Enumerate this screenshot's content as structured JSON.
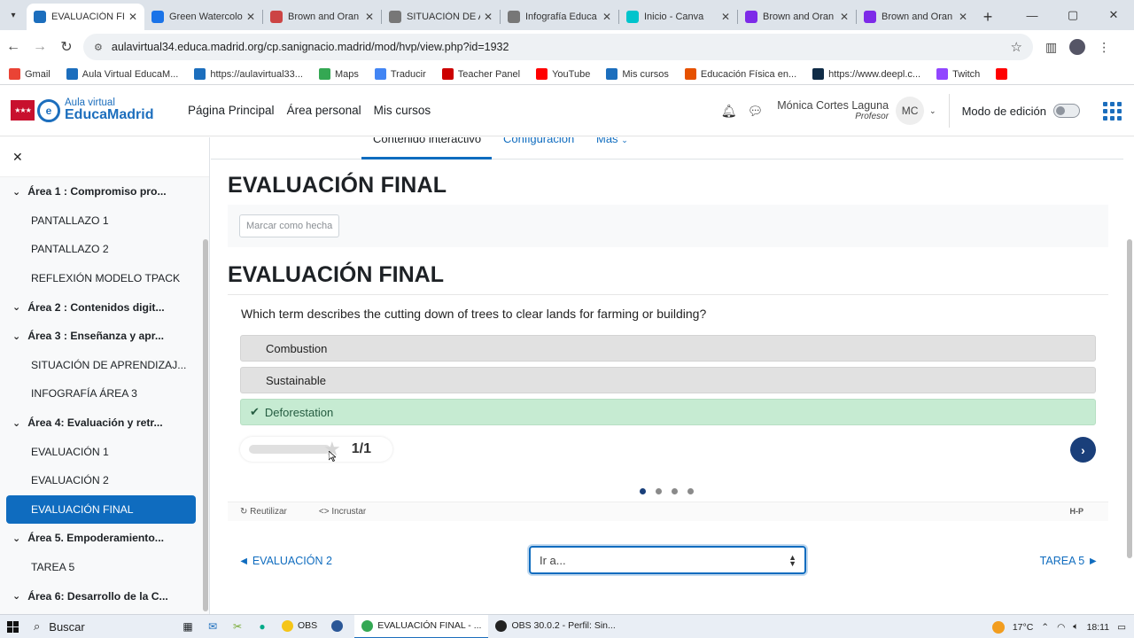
{
  "browser": {
    "tabs": [
      {
        "label": "EVALUACIÓN FIN",
        "active": true,
        "color": "#1c6ebd"
      },
      {
        "label": "Green Watercolo",
        "color": "#1a73e8"
      },
      {
        "label": "Brown and Oran",
        "color": "#c44"
      },
      {
        "label": "SITUACIÓN DE A",
        "color": "#777"
      },
      {
        "label": "Infografía Educa",
        "color": "#777"
      },
      {
        "label": "Inicio - Canva",
        "color": "#00c4cc"
      },
      {
        "label": "Brown and Oran",
        "color": "#7d2ae8"
      },
      {
        "label": "Brown and Oran",
        "color": "#7d2ae8"
      }
    ],
    "url": "aulavirtual34.educa.madrid.org/cp.sanignacio.madrid/mod/hvp/view.php?id=1932",
    "bookmarks": [
      {
        "label": "Gmail",
        "color": "#ea4335"
      },
      {
        "label": "Aula Virtual EducaM...",
        "color": "#1c6ebd"
      },
      {
        "label": "https://aulavirtual33...",
        "color": "#1c6ebd"
      },
      {
        "label": "Maps",
        "color": "#34a853"
      },
      {
        "label": "Traducir",
        "color": "#4285f4"
      },
      {
        "label": "Teacher Panel",
        "color": "#c00"
      },
      {
        "label": "YouTube",
        "color": "#f00"
      },
      {
        "label": "Mis cursos",
        "color": "#1c6ebd"
      },
      {
        "label": "Educación Física en...",
        "color": "#e65100"
      },
      {
        "label": "https://www.deepl.c...",
        "color": "#0f2b46"
      },
      {
        "label": "Twitch",
        "color": "#9146ff"
      },
      {
        "label": "",
        "color": "#f00"
      }
    ]
  },
  "site": {
    "logo_small": "Aula virtual",
    "logo_big": "EducaMadrid",
    "nav": [
      "Página Principal",
      "Área personal",
      "Mis cursos"
    ],
    "user_name": "Mónica Cortes Laguna",
    "user_role": "Profesor",
    "user_initials": "MC",
    "edit_mode_label": "Modo de edición",
    "accent": "#0f6cbf"
  },
  "sidebar": {
    "items": [
      {
        "label": "Área 1 : Compromiso pro...",
        "type": "section"
      },
      {
        "label": "PANTALLAZO 1",
        "type": "item"
      },
      {
        "label": "PANTALLAZO 2",
        "type": "item"
      },
      {
        "label": "REFLEXIÓN MODELO TPACK",
        "type": "item"
      },
      {
        "label": "Área 2 : Contenidos digit...",
        "type": "section"
      },
      {
        "label": "Área 3 : Enseñanza y apr...",
        "type": "section"
      },
      {
        "label": "SITUACIÓN DE APRENDIZAJ...",
        "type": "item"
      },
      {
        "label": "INFOGRAFÍA ÁREA 3",
        "type": "item"
      },
      {
        "label": "Área 4: Evaluación y retr...",
        "type": "section"
      },
      {
        "label": "EVALUACIÓN 1",
        "type": "item"
      },
      {
        "label": "EVALUACIÓN 2",
        "type": "item"
      },
      {
        "label": "EVALUACIÓN FINAL",
        "type": "active"
      },
      {
        "label": "Área 5. Empoderamiento...",
        "type": "section"
      },
      {
        "label": "TAREA 5",
        "type": "item"
      },
      {
        "label": "Área 6: Desarrollo de la C...",
        "type": "section"
      }
    ]
  },
  "main": {
    "tabs": [
      "Contenido interactivo",
      "Configuración",
      "Más"
    ],
    "title": "EVALUACIÓN FINAL",
    "mark_done": "Marcar como hecha",
    "activity_title": "EVALUACIÓN FINAL",
    "question": "Which term describes the cutting down of trees to clear lands for farming or building?",
    "answers": [
      {
        "label": "Combustion",
        "correct": false
      },
      {
        "label": "Sustainable",
        "correct": false
      },
      {
        "label": "Deforestation",
        "correct": true
      }
    ],
    "score_text": "1/1",
    "score_fraction": 1.0,
    "slides_total": 4,
    "slide_current": 1,
    "reuse_label": "Reutilizar",
    "embed_label": "Incrustar",
    "h5p_mark": "H-P",
    "prev_link": "◄ EVALUACIÓN 2",
    "next_link": "TAREA 5 ►",
    "jump_placeholder": "Ir a..."
  },
  "taskbar": {
    "search": "Buscar",
    "apps": [
      {
        "label": "OBS",
        "color": "#f5c518"
      },
      {
        "label": "",
        "color": "#2b5797"
      },
      {
        "label": "EVALUACIÓN FINAL - ...",
        "color": "#34a853",
        "selected": true
      },
      {
        "label": "OBS 30.0.2 - Perfil: Sin...",
        "color": "#222"
      }
    ],
    "temperature": "17°C",
    "time": "18:11"
  }
}
